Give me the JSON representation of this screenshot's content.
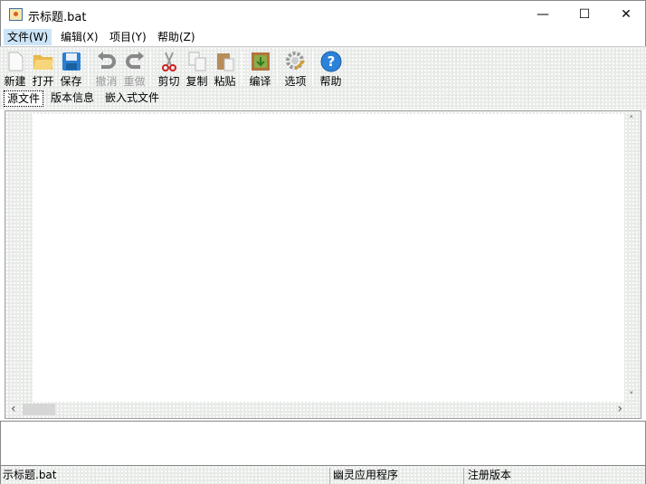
{
  "window": {
    "title": "示标题.bat",
    "minimize": "—",
    "maximize": "☐",
    "close": "✕"
  },
  "menu": [
    "文件(W)",
    "编辑(X)",
    "项目(Y)",
    "帮助(Z)"
  ],
  "toolbar": {
    "new": "新建",
    "open": "打开",
    "save": "保存",
    "undo": "撤消",
    "redo": "重做",
    "cut": "剪切",
    "copy": "复制",
    "paste": "粘贴",
    "compile": "编译",
    "options": "选项",
    "help": "帮助"
  },
  "tabs": [
    "源文件",
    "版本信息",
    "嵌入式文件"
  ],
  "scroll": {
    "up": "˄",
    "down": "˅",
    "left": "‹",
    "right": "›"
  },
  "status": {
    "file": "示标题.bat",
    "app": "幽灵应用程序",
    "version": "注册版本"
  }
}
